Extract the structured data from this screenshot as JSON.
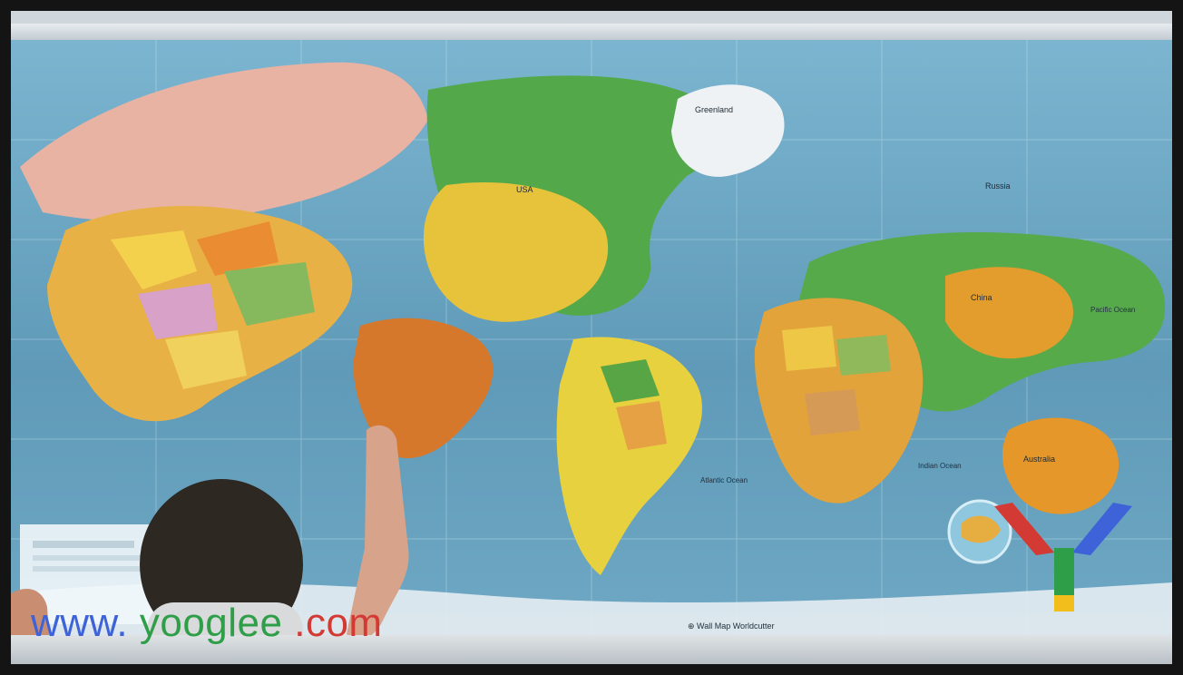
{
  "map": {
    "bottom_credit": "⊕ Wall Map Worldcutter",
    "labels": {
      "us": "USA",
      "greenland": "Greenland",
      "russia": "Russia",
      "china": "China",
      "australia": "Australia",
      "ocean_pacific": "Pacific Ocean",
      "ocean_atlantic": "Atlantic Ocean",
      "ocean_indian": "Indian Ocean"
    }
  },
  "watermark": {
    "prefix": "www.",
    "brand": "yooglee",
    "suffix": ".com"
  },
  "colors": {
    "ocean": "#5f9ab8",
    "ocean_light": "#95c3d8",
    "greenland": "#e8ecef",
    "accent_blue": "#3e63d9",
    "accent_green": "#2f9e48",
    "accent_red": "#d43a34",
    "accent_yellow": "#f2be1b"
  },
  "icons": {
    "logo": "yooglee-y-logo",
    "globe": "globe-icon"
  }
}
